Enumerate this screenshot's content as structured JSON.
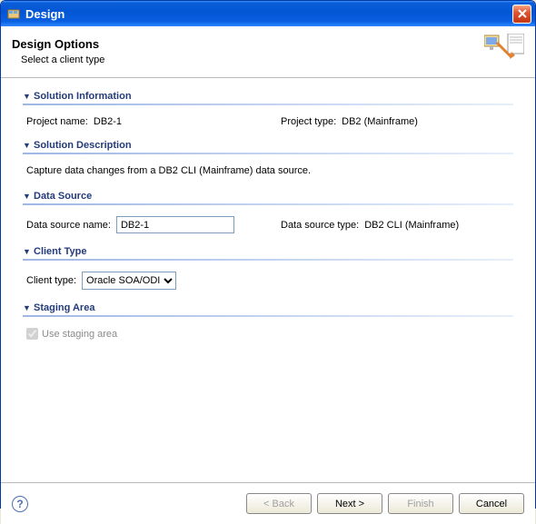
{
  "window": {
    "title": "Design"
  },
  "header": {
    "title": "Design Options",
    "subtitle": "Select a client type"
  },
  "sections": {
    "solution_info": {
      "title": "Solution Information",
      "project_name_label": "Project name:",
      "project_name_value": "DB2-1",
      "project_type_label": "Project type:",
      "project_type_value": "DB2 (Mainframe)"
    },
    "solution_desc": {
      "title": "Solution Description",
      "text": "Capture data changes from a DB2 CLI (Mainframe) data source."
    },
    "data_source": {
      "title": "Data Source",
      "name_label": "Data source name:",
      "name_value": "DB2-1",
      "type_label": "Data source type:",
      "type_value": "DB2 CLI (Mainframe)"
    },
    "client_type": {
      "title": "Client Type",
      "label": "Client type:",
      "selected": "Oracle SOA/ODI"
    },
    "staging": {
      "title": "Staging Area",
      "checkbox_label": "Use staging area"
    }
  },
  "footer": {
    "back": "< Back",
    "next": "Next >",
    "finish": "Finish",
    "cancel": "Cancel"
  }
}
